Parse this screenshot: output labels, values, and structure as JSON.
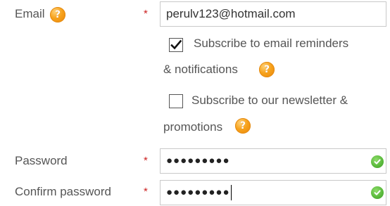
{
  "form": {
    "required_marker": "*",
    "email": {
      "label": "Email",
      "value": "perulv123@hotmail.com",
      "help_icon": "question-mark-icon"
    },
    "subscribe_reminders": {
      "checked": true,
      "line1": "Subscribe to email reminders",
      "line2": "& notifications",
      "help_icon": "question-mark-icon"
    },
    "subscribe_newsletter": {
      "checked": false,
      "line1": "Subscribe to our newsletter &",
      "line2": "promotions",
      "help_icon": "question-mark-icon"
    },
    "password": {
      "label": "Password",
      "masked_value": "●●●●●●●●●",
      "status_icon": "check-circle-icon"
    },
    "confirm_password": {
      "label": "Confirm password",
      "masked_value": "●●●●●●●●●",
      "status_icon": "check-circle-icon"
    }
  },
  "colors": {
    "help_icon": "#f7a21b",
    "valid_icon": "#58b83a",
    "required_marker": "#cc2222",
    "label_text": "#555555",
    "input_border": "#c9c9c9"
  }
}
